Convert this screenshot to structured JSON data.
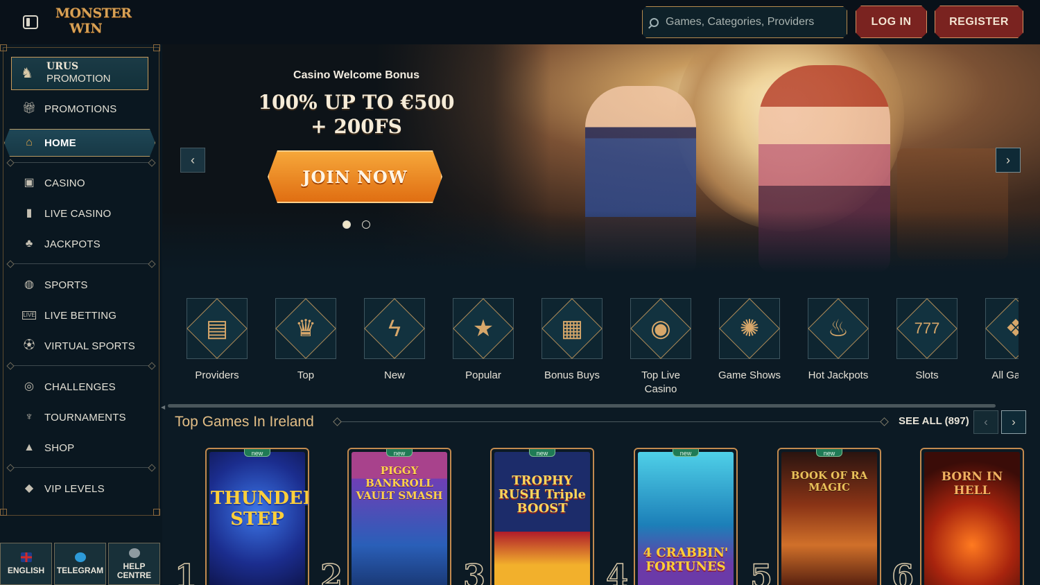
{
  "header": {
    "logo_line1": "MONSTER",
    "logo_line2": "WIN",
    "search_placeholder": "Games, Categories, Providers",
    "login_label": "LOG IN",
    "register_label": "REGISTER"
  },
  "sidebar": {
    "promo": {
      "line1": "URUS",
      "line2": "PROMOTION"
    },
    "items": [
      {
        "label": "PROMOTIONS",
        "icon": "gift-icon"
      },
      {
        "label": "HOME",
        "icon": "home-icon"
      },
      {
        "label": "CASINO",
        "icon": "slot-machine-icon"
      },
      {
        "label": "LIVE CASINO",
        "icon": "card-icon"
      },
      {
        "label": "JACKPOTS",
        "icon": "clover-icon"
      },
      {
        "label": "SPORTS",
        "icon": "basketball-icon"
      },
      {
        "label": "LIVE BETTING",
        "icon": "live-icon"
      },
      {
        "label": "VIRTUAL SPORTS",
        "icon": "virtual-icon"
      },
      {
        "label": "CHALLENGES",
        "icon": "target-icon"
      },
      {
        "label": "TOURNAMENTS",
        "icon": "trophy-icon"
      },
      {
        "label": "SHOP",
        "icon": "bag-icon"
      },
      {
        "label": "VIP LEVELS",
        "icon": "diamond-icon"
      }
    ],
    "bottom": {
      "language": "ENGLISH",
      "telegram": "TELEGRAM",
      "help": "HELP CENTRE"
    }
  },
  "hero": {
    "subtitle": "Casino Welcome Bonus",
    "title_line1": "100% UP TO €500",
    "title_line2": "+ 200FS",
    "cta": "JOIN NOW",
    "slides": 2,
    "active_slide": 1
  },
  "categories": [
    {
      "label": "Providers",
      "icon": "book-icon"
    },
    {
      "label": "Top",
      "icon": "crown-icon"
    },
    {
      "label": "New",
      "icon": "lightning-icon"
    },
    {
      "label": "Popular",
      "icon": "star-icon"
    },
    {
      "label": "Bonus Buys",
      "icon": "gift-box-icon"
    },
    {
      "label": "Top Live Casino",
      "icon": "chip-icon"
    },
    {
      "label": "Game Shows",
      "icon": "wheel-icon"
    },
    {
      "label": "Hot Jackpots",
      "icon": "flame-icon"
    },
    {
      "label": "Slots",
      "icon": "slot-icon"
    },
    {
      "label": "All Games",
      "icon": "all-games-icon"
    }
  ],
  "top_games": {
    "title": "Top Games In Ireland",
    "see_all": "SEE ALL (897)",
    "new_badge": "new",
    "games": [
      {
        "rank": "1",
        "name": "THUNDER STEP",
        "is_new": true
      },
      {
        "rank": "2",
        "name": "PIGGY BANKROLL VAULT SMASH",
        "is_new": true
      },
      {
        "rank": "3",
        "name": "TROPHY RUSH Triple BOOST",
        "is_new": true
      },
      {
        "rank": "4",
        "name": "4 CRABBIN' FORTUNES",
        "is_new": true
      },
      {
        "rank": "5",
        "name": "BOOK OF RA MAGIC",
        "is_new": true
      },
      {
        "rank": "6",
        "name": "BORN IN HELL",
        "is_new": false
      }
    ]
  },
  "colors": {
    "background": "#0c1a24",
    "accent_gold": "#c99b5b",
    "button_red": "#7a2320",
    "cta_orange": "#f08a22"
  }
}
